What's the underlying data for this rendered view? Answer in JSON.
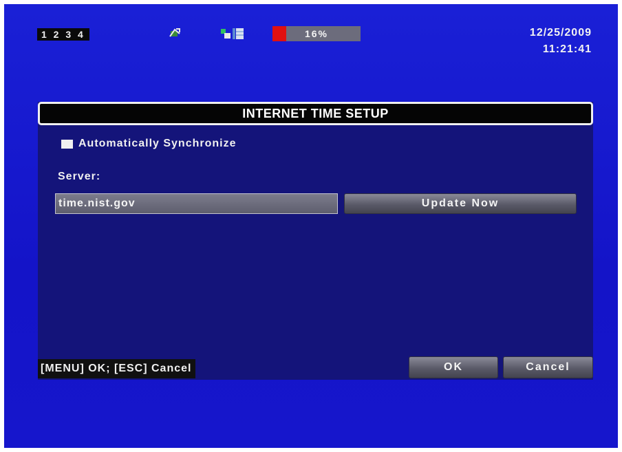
{
  "status_bar": {
    "channels": "1 2 3 4",
    "icons": [
      "network-icon",
      "hdd-status-icon"
    ],
    "disk_usage_label": "16%",
    "disk_usage_fraction": 0.16,
    "date": "12/25/2009",
    "time": "11:21:41"
  },
  "dialog": {
    "title": "INTERNET TIME SETUP",
    "auto_sync_label": "Automatically Synchronize",
    "server_label": "Server:",
    "server_value": "time.nist.gov",
    "update_button": "Update Now",
    "hint": "[MENU] OK; [ESC] Cancel",
    "ok_button": "OK",
    "cancel_button": "Cancel"
  },
  "colors": {
    "background": "#1616cc",
    "dialog": "#14147a",
    "progress_fill": "#e01010"
  }
}
